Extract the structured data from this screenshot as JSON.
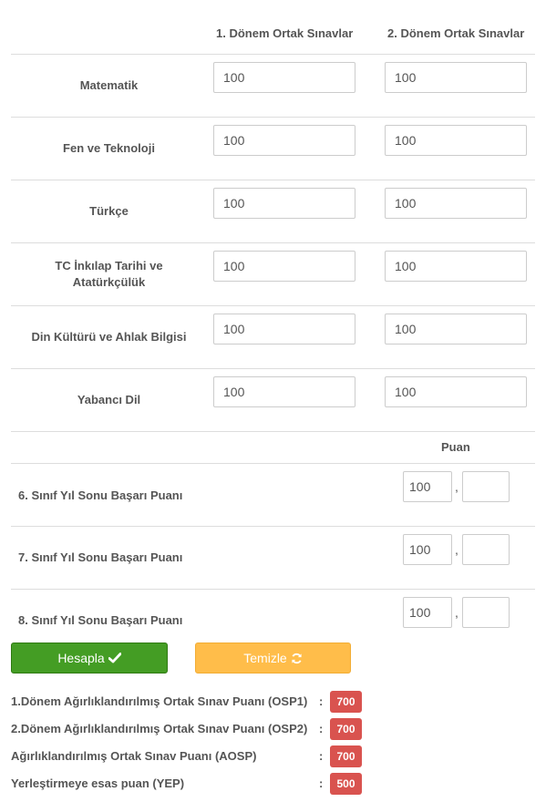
{
  "header": {
    "col1": "1. Dönem Ortak Sınavlar",
    "col2": "2. Dönem Ortak Sınavlar"
  },
  "subjects": [
    {
      "label": "Matematik",
      "v1": "100",
      "v2": "100"
    },
    {
      "label": "Fen ve Teknoloji",
      "v1": "100",
      "v2": "100"
    },
    {
      "label": "Türkçe",
      "v1": "100",
      "v2": "100"
    },
    {
      "label_line1": "TC İnkılap Tarihi ve",
      "label_line2": "Atatürkçülük",
      "v1": "100",
      "v2": "100"
    },
    {
      "label": "Din Kültürü ve Ahlak Bilgisi",
      "v1": "100",
      "v2": "100"
    },
    {
      "label": "Yabancı Dil",
      "v1": "100",
      "v2": "100"
    }
  ],
  "score_header": "Puan",
  "year_scores": [
    {
      "label": "6. Sınıf Yıl Sonu Başarı Puanı",
      "int": "100",
      "dec": "",
      "sep": ","
    },
    {
      "label": "7.  Sınıf Yıl Sonu Başarı Puanı",
      "int": "100",
      "dec": "",
      "sep": ","
    },
    {
      "label": "8.  Sınıf Yıl Sonu Başarı Puanı",
      "int": "100",
      "dec": "",
      "sep": ","
    }
  ],
  "buttons": {
    "calculate": "Hesapla",
    "calculate_icon": "check-icon",
    "clear": "Temizle",
    "clear_icon": "refresh-icon"
  },
  "results": [
    {
      "label": "1.Dönem Ağırlıklandırılmış Ortak Sınav Puanı (OSP1)",
      "colon": ":",
      "value": "700"
    },
    {
      "label": "2.Dönem Ağırlıklandırılmış Ortak Sınav Puanı (OSP2)",
      "colon": ":",
      "value": "700"
    },
    {
      "label": "Ağırlıklandırılmış Ortak Sınav Puanı (AOSP)",
      "colon": ":",
      "value": "700"
    },
    {
      "label": "Yerleştirmeye esas puan (YEP)",
      "colon": ":",
      "value": "500"
    }
  ],
  "colors": {
    "calculate": "#449d24",
    "clear": "#ffbd4a",
    "badge": "#d9534f",
    "divider": "#dddddd"
  }
}
